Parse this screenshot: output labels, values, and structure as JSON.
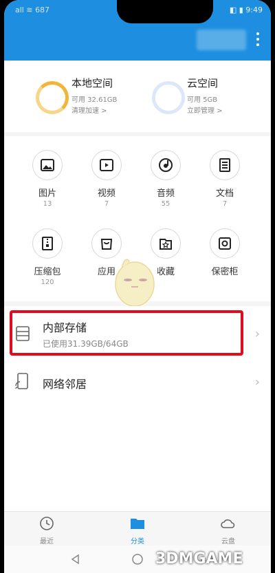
{
  "status": {
    "left": "all ≋ 687",
    "right": "◧ ▮ 9:49"
  },
  "header": {
    "menu_icon": "more-vert-icon",
    "accent": "#1e8fe0"
  },
  "storage": {
    "local": {
      "title": "本地空间",
      "available": "可用 32.61GB",
      "action": "清理加速 >"
    },
    "cloud": {
      "title": "云空间",
      "available": "可用 5GB",
      "action": "立即管理 >"
    }
  },
  "categories": [
    {
      "label": "图片",
      "count": "13",
      "icon": "image-icon"
    },
    {
      "label": "视频",
      "count": "7",
      "icon": "video-icon"
    },
    {
      "label": "音频",
      "count": "55",
      "icon": "audio-icon"
    },
    {
      "label": "文档",
      "count": "7",
      "icon": "document-icon"
    },
    {
      "label": "压缩包",
      "count": "120",
      "icon": "archive-icon"
    },
    {
      "label": "应用",
      "count": "",
      "icon": "app-icon"
    },
    {
      "label": "收藏",
      "count": "",
      "icon": "favorite-icon"
    },
    {
      "label": "保密柜",
      "count": "",
      "icon": "safe-icon"
    }
  ],
  "list": {
    "internal": {
      "title": "内部存储",
      "usage": "已使用31.39GB/64GB"
    },
    "network": {
      "title": "网络邻居"
    }
  },
  "bottom_nav": [
    {
      "label": "最近",
      "icon": "clock-icon"
    },
    {
      "label": "分类",
      "icon": "folder-icon",
      "active": true
    },
    {
      "label": "云盘",
      "icon": "cloud-icon"
    }
  ],
  "watermark": "3DMGAME",
  "highlight_color": "#e00b1c"
}
